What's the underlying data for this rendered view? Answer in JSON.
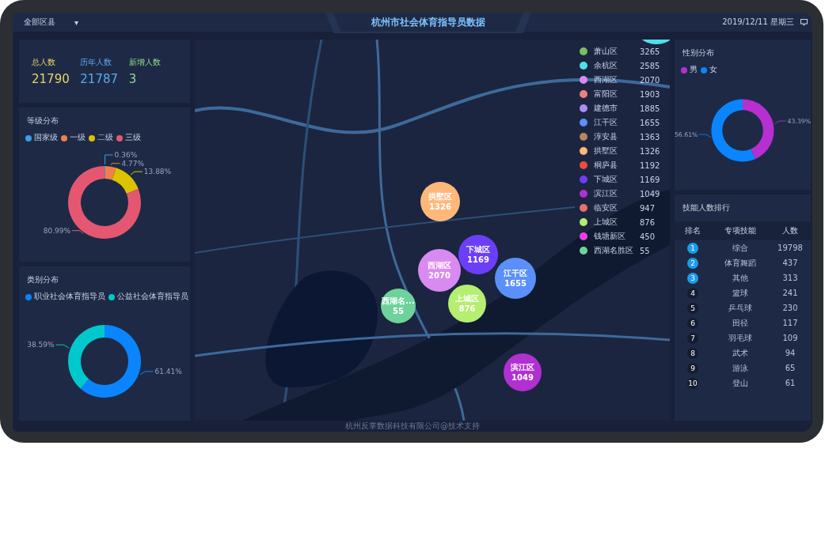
{
  "header": {
    "district_select": {
      "value": "全部区县",
      "caret": "▾"
    },
    "title": "杭州市社会体育指导员数据",
    "date": "2019/12/11 星期三"
  },
  "stats": [
    {
      "label": "总人数",
      "value": "21790",
      "color": "#e6d36a"
    },
    {
      "label": "历年人数",
      "value": "21787",
      "color": "#5aa8f0"
    },
    {
      "label": "新增人数",
      "value": "3",
      "color": "#8fd88a"
    }
  ],
  "grade_panel": {
    "title": "等级分布",
    "chart_data": {
      "type": "donut",
      "legend": true,
      "categories": [
        "国家级",
        "一级",
        "二级",
        "三级"
      ],
      "colors": [
        "#3a9de6",
        "#f0804a",
        "#dcc300",
        "#e55770"
      ],
      "values": [
        0.36,
        4.77,
        13.88,
        80.99
      ],
      "value_labels": [
        "0.36%",
        "4.77%",
        "13.88%",
        "80.99%"
      ]
    }
  },
  "category_panel": {
    "title": "类别分布",
    "chart_data": {
      "type": "donut",
      "legend": true,
      "categories": [
        "职业社会体育指导员",
        "公益社会体育指导员"
      ],
      "colors": [
        "#0a85ff",
        "#00c8cc"
      ],
      "values": [
        61.41,
        38.59
      ],
      "value_labels": [
        "61.41%",
        "38.59%"
      ]
    }
  },
  "map": {
    "bubbles": [
      {
        "label": "拱墅区",
        "value": "1326",
        "color": "#ffb87a"
      },
      {
        "label": "西湖区",
        "value": "2070",
        "color": "#d98af0"
      },
      {
        "label": "下城区",
        "value": "1169",
        "color": "#6b3ff8"
      },
      {
        "label": "江干区",
        "value": "1655",
        "color": "#5b8ff9"
      },
      {
        "label": "西湖名...",
        "value": "55",
        "color": "#6dd39a"
      },
      {
        "label": "上城区",
        "value": "876",
        "color": "#b5ee70"
      },
      {
        "label": "滨江区",
        "value": "1049",
        "color": "#b030d0"
      }
    ],
    "legend": [
      {
        "label": "萧山区",
        "value": "3265",
        "color": "#7ec060"
      },
      {
        "label": "余杭区",
        "value": "2585",
        "color": "#4de0e8"
      },
      {
        "label": "西湖区",
        "value": "2070",
        "color": "#d98af0"
      },
      {
        "label": "富阳区",
        "value": "1903",
        "color": "#f08080"
      },
      {
        "label": "建德市",
        "value": "1885",
        "color": "#a98cf8"
      },
      {
        "label": "江干区",
        "value": "1655",
        "color": "#5b8ff9"
      },
      {
        "label": "淳安县",
        "value": "1363",
        "color": "#b8865a"
      },
      {
        "label": "拱墅区",
        "value": "1326",
        "color": "#ffb87a"
      },
      {
        "label": "桐庐县",
        "value": "1192",
        "color": "#f04a3a"
      },
      {
        "label": "下城区",
        "value": "1169",
        "color": "#6b3ff8"
      },
      {
        "label": "滨江区",
        "value": "1049",
        "color": "#b030d0"
      },
      {
        "label": "临安区",
        "value": "947",
        "color": "#e87070"
      },
      {
        "label": "上城区",
        "value": "876",
        "color": "#b5ee70"
      },
      {
        "label": "钱塘新区",
        "value": "450",
        "color": "#f040e0"
      },
      {
        "label": "西湖名胜区",
        "value": "55",
        "color": "#6dd39a"
      }
    ]
  },
  "gender_panel": {
    "title": "性别分布",
    "chart_data": {
      "type": "donut",
      "legend": true,
      "categories": [
        "男",
        "女"
      ],
      "colors": [
        "#b62fd0",
        "#0a85ff"
      ],
      "values": [
        43.39,
        56.61
      ],
      "value_labels": [
        "43.39%",
        "56.61%"
      ]
    }
  },
  "skills_panel": {
    "title": "技能人数排行",
    "columns": [
      "排名",
      "专项技能",
      "人数"
    ],
    "rows": [
      {
        "rank": "1",
        "skill": "综合",
        "count": "19798",
        "highlighted": true
      },
      {
        "rank": "2",
        "skill": "体育舞蹈",
        "count": "437",
        "highlighted": true
      },
      {
        "rank": "3",
        "skill": "其他",
        "count": "313",
        "highlighted": true
      },
      {
        "rank": "4",
        "skill": "篮球",
        "count": "241",
        "highlighted": false
      },
      {
        "rank": "5",
        "skill": "乒乓球",
        "count": "230",
        "highlighted": false
      },
      {
        "rank": "6",
        "skill": "田径",
        "count": "117",
        "highlighted": false
      },
      {
        "rank": "7",
        "skill": "羽毛球",
        "count": "109",
        "highlighted": false
      },
      {
        "rank": "8",
        "skill": "武术",
        "count": "94",
        "highlighted": false
      },
      {
        "rank": "9",
        "skill": "游泳",
        "count": "65",
        "highlighted": false
      },
      {
        "rank": "10",
        "skill": "登山",
        "count": "61",
        "highlighted": false
      }
    ]
  },
  "footer": "杭州反掌数据科技有限公司@技术支持"
}
